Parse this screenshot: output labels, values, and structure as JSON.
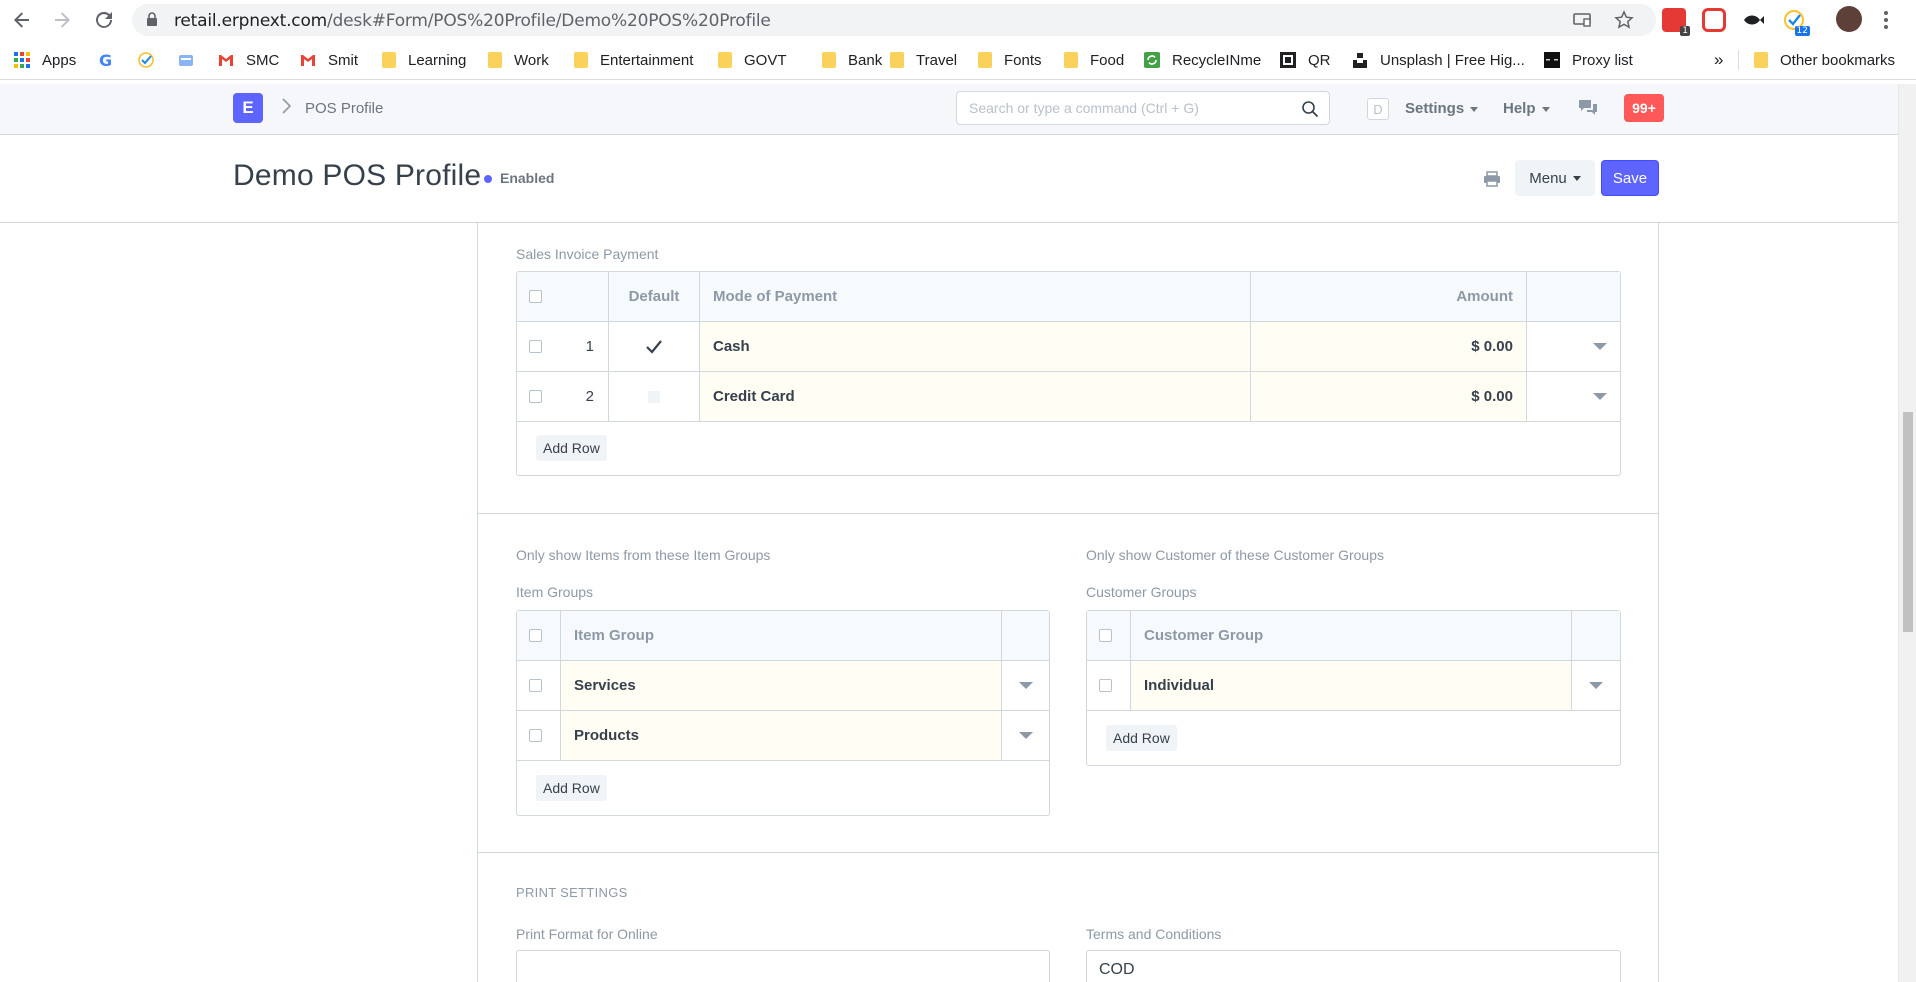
{
  "browser": {
    "url_host": "retail.erpnext.com",
    "url_path": "/desk#Form/POS%20Profile/Demo%20POS%20Profile",
    "extension_badges": {
      "ext1": "1",
      "ext4": "12"
    },
    "bookmarks": [
      {
        "label": "Apps",
        "icon": "apps-grid-icon"
      },
      {
        "label": "",
        "icon": "google-icon"
      },
      {
        "label": "",
        "icon": "checkmark-app-icon"
      },
      {
        "label": "",
        "icon": "drive-icon"
      },
      {
        "label": "SMC",
        "icon": "gmail-icon"
      },
      {
        "label": "Smit",
        "icon": "gmail-icon"
      },
      {
        "label": "Learning",
        "icon": "folder-icon"
      },
      {
        "label": "Work",
        "icon": "folder-icon"
      },
      {
        "label": "Entertainment",
        "icon": "folder-icon"
      },
      {
        "label": "GOVT",
        "icon": "folder-icon"
      },
      {
        "label": "Bank",
        "icon": "folder-icon"
      },
      {
        "label": "Travel",
        "icon": "folder-icon"
      },
      {
        "label": "Fonts",
        "icon": "folder-icon"
      },
      {
        "label": "Food",
        "icon": "folder-icon"
      },
      {
        "label": "RecycleINme",
        "icon": "recycle-icon"
      },
      {
        "label": "QR",
        "icon": "qr-icon"
      },
      {
        "label": "Unsplash | Free Hig...",
        "icon": "unsplash-icon"
      },
      {
        "label": "Proxy list",
        "icon": "proxy-icon"
      }
    ],
    "more_label": "»",
    "other_bookmarks": "Other bookmarks"
  },
  "navbar": {
    "logo_letter": "E",
    "breadcrumb": "POS Profile",
    "search_placeholder": "Search or type a command (Ctrl + G)",
    "avatar_letter": "D",
    "settings_label": "Settings",
    "help_label": "Help",
    "notifications": "99+"
  },
  "page": {
    "title": "Demo POS Profile",
    "status": "Enabled",
    "menu_label": "Menu",
    "save_label": "Save"
  },
  "payments": {
    "label": "Sales Invoice Payment",
    "columns": [
      "Default",
      "Mode of Payment",
      "Amount"
    ],
    "rows": [
      {
        "idx": "1",
        "default": true,
        "mode": "Cash",
        "amount": "$ 0.00"
      },
      {
        "idx": "2",
        "default": false,
        "mode": "Credit Card",
        "amount": "$ 0.00"
      }
    ],
    "add_row": "Add Row"
  },
  "item_groups": {
    "section_label": "Only show Items from these Item Groups",
    "label": "Item Groups",
    "column": "Item Group",
    "rows": [
      "Services",
      "Products"
    ],
    "add_row": "Add Row"
  },
  "customer_groups": {
    "section_label": "Only show Customer of these Customer Groups",
    "label": "Customer Groups",
    "column": "Customer Group",
    "rows": [
      "Individual"
    ],
    "add_row": "Add Row"
  },
  "print_settings": {
    "heading": "PRINT SETTINGS",
    "print_format_label": "Print Format for Online",
    "print_format_value": "",
    "terms_label": "Terms and Conditions",
    "terms_value": "COD"
  },
  "colors": {
    "primary": "#5e64ff",
    "notification": "#ff5858",
    "editable_cell": "#fffdf4"
  }
}
